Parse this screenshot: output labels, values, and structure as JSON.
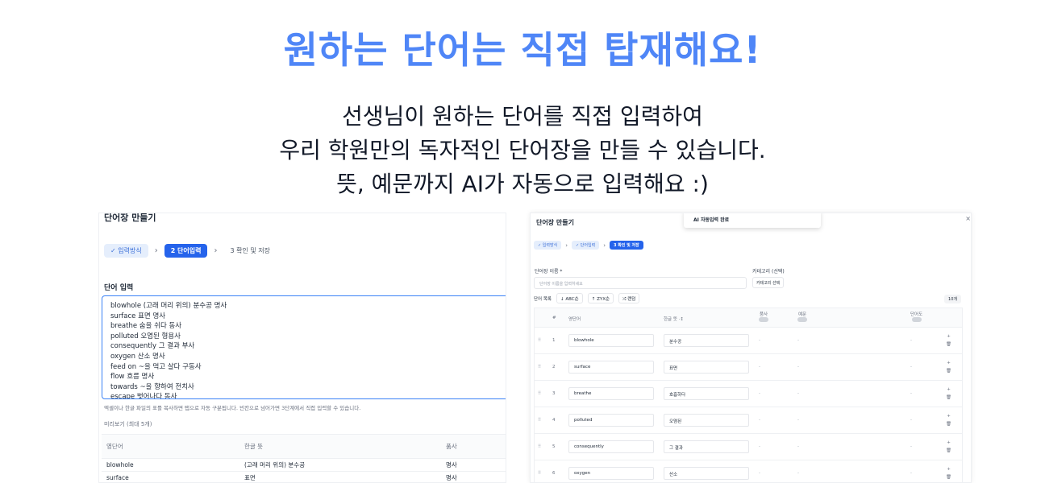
{
  "hero": {
    "title": "원하는 단어는 직접 탑재해요!",
    "lines": [
      "선생님이 원하는 단어를 직접 입력하여",
      "우리 학원만의 독자적인 단어장을 만들 수 있습니다.",
      "뜻, 예문까지 AI가 자동으로 입력해요 :)"
    ]
  },
  "left": {
    "title": "단어장 만들기",
    "steps": [
      "✓ 입력방식",
      "2 단어입력",
      "3 확인 및 저장"
    ],
    "section": "단어 입력",
    "entries": [
      "blowhole    (고래 머리 위의) 분수공 명사",
      "surface   표면 명사",
      "breathe   숨을 쉬다  동사",
      "polluted  오염된  형용사",
      "consequently     그 결과 부사",
      "oxygen    산소 명사",
      "feed on   ~을 먹고 살다   구동사",
      "flow    흐름 명사",
      "towards   ~을 향하여    전치사",
      "escape    벗어나다   동사"
    ],
    "hint": "엑셀이나 한글 파일의 표를 복사하면 탭으로 자동 구분됩니다. 빈칸으로 넘어가면 3단계에서 직접 입력할 수 있습니다.",
    "preview_label": "미리보기 (최대 5개)",
    "preview_headers": [
      "영단어",
      "한글 뜻",
      "품사"
    ],
    "preview_rows": [
      [
        "blowhole",
        "(고래 머리 위의) 분수공",
        "명사"
      ],
      [
        "surface",
        "표면",
        "명사"
      ]
    ]
  },
  "right": {
    "title": "단어장 만들기",
    "toast": "AI 자동입력 완료",
    "close": "×",
    "steps": [
      "✓ 입력방식",
      "✓ 단어입력",
      "3 확인 및 저장"
    ],
    "name_label": "단어장 이름 *",
    "name_placeholder": "단어장 이름을 입력하세요",
    "category_label": "카테고리 (선택)",
    "category_button": "카테고리 선택",
    "list_label": "단어 목록",
    "sort_buttons": [
      "ABC순",
      "ZYX순",
      "랜덤"
    ],
    "count": "10개",
    "headers": [
      "#",
      "영단어",
      "한글 뜻 ·↕",
      "품사",
      "예문",
      "단어도"
    ],
    "rows": [
      {
        "n": "1",
        "en": "blowhole",
        "ko": "분수공"
      },
      {
        "n": "2",
        "en": "surface",
        "ko": "표면"
      },
      {
        "n": "3",
        "en": "breathe",
        "ko": "호흡하다"
      },
      {
        "n": "4",
        "en": "polluted",
        "ko": "오염된"
      },
      {
        "n": "5",
        "en": "consequently",
        "ko": "그 결과"
      },
      {
        "n": "6",
        "en": "oxygen",
        "ko": "산소"
      }
    ]
  }
}
